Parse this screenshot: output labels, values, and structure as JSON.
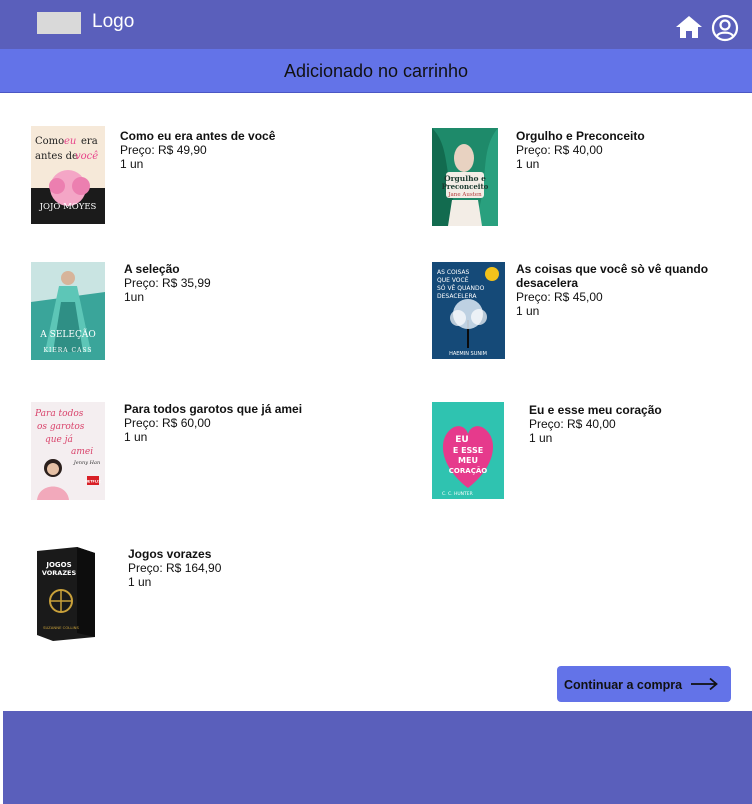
{
  "header": {
    "logo_label": "Logo",
    "home_icon": "home-icon",
    "user_icon": "user-circle-icon"
  },
  "banner": {
    "title": "Adicionado no carrinho"
  },
  "cart": {
    "items": [
      {
        "name": "Como eu era antes de você",
        "price": "Preço: R$ 49,90",
        "qty": "1 un",
        "cover": {
          "line1": "Como",
          "line2": "eu",
          "line3": "era",
          "line4": "antes de",
          "line5": "você",
          "author": "JOJO MOYES",
          "bg": "#f6e9d9",
          "accent": "#e7438a"
        }
      },
      {
        "name": "Orgulho e Preconceito",
        "price": "Preço: R$ 40,00",
        "qty": "1 un",
        "cover": {
          "line1": "Orgulho e",
          "line2": "Preconceito",
          "author": "Jane Austen",
          "bg": "#1e8a6a"
        }
      },
      {
        "name": "A seleção",
        "price": "Preço:  R$ 35,99",
        "qty": "1un",
        "cover": {
          "line1": "A SELEÇÃO",
          "author": "KIERA CASS",
          "bg": "#3aa59a"
        }
      },
      {
        "name": "As coisas que você sò vê  quando desacelera",
        "price": "Preço: R$  45,00",
        "qty": "1 un",
        "cover": {
          "line1": "AS COISAS",
          "line2": "QUE VOCÊ",
          "line3": "SÓ VÊ QUANDO",
          "line4": "DESACELERA",
          "author": "HAEMIN SUNIM",
          "bg": "#154a78",
          "sun": "#f2c21b"
        }
      },
      {
        "name": "Para todos garotos que já amei",
        "price": "Preço: R$ 60,00",
        "qty": "1 un",
        "cover": {
          "line1": "Para todos",
          "line2": "os garotos",
          "line3": "que já",
          "line4": "amei",
          "author": "Jenny Han",
          "badge": "NETFLIX",
          "bg": "#f4eef0",
          "accent": "#d9436b"
        }
      },
      {
        "name": "Eu e esse meu coração",
        "price": "Preço: R$ 40,00",
        "qty": "1 un",
        "cover": {
          "line1": "EU",
          "line2": "E ESSE",
          "line3": "MEU",
          "line4": "CORAÇÃO",
          "author": "C. C. HUNTER",
          "bg": "#2fc3b0",
          "accent": "#e63a8c"
        }
      },
      {
        "name": "Jogos vorazes",
        "price": "Preço:  R$ 164,90",
        "qty": "1 un",
        "cover": {
          "line1": "JOGOS",
          "line2": "VORAZES",
          "author": "SUZANNE COLLINS",
          "bg": "#1a1a1a",
          "accent": "#c9a13a"
        }
      }
    ]
  },
  "actions": {
    "continue_label": "Continuar a compra",
    "continue_icon": "arrow-right-icon"
  },
  "colors": {
    "header": "#5a5fbb",
    "banner": "#6373e8",
    "button": "#6373e8",
    "footer": "#5a5fbb"
  }
}
